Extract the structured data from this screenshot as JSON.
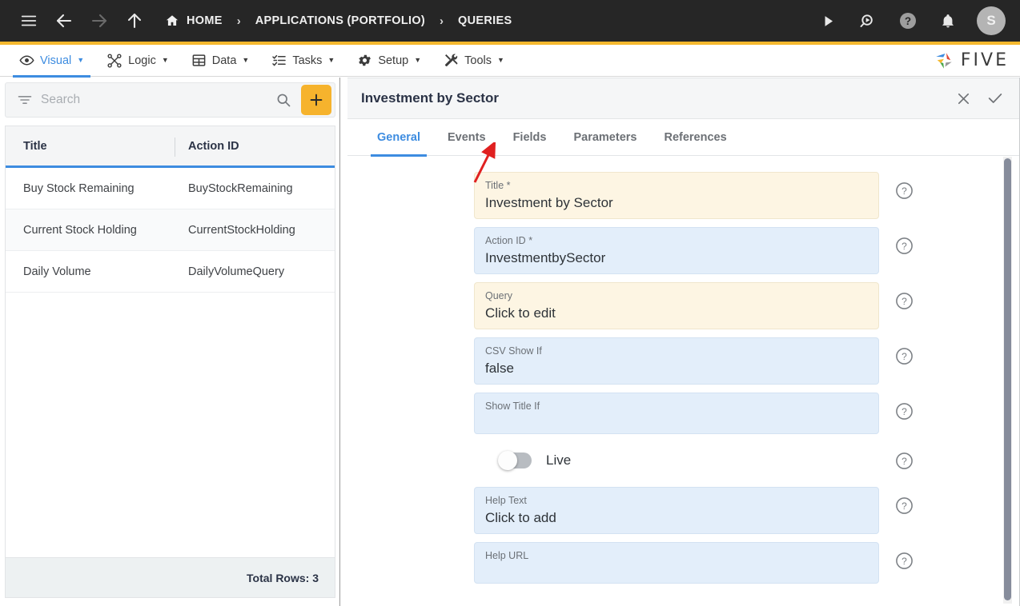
{
  "topbar": {
    "icons": {
      "menu": "hamburger-icon",
      "back": "arrow-left-icon",
      "forward": "arrow-right-icon",
      "up": "arrow-up-icon",
      "run": "play-icon",
      "search": "search-play-icon",
      "help": "question-circle-icon",
      "notifications": "bell-icon"
    },
    "breadcrumbs": [
      {
        "label": "HOME",
        "icon": "home-icon"
      },
      {
        "label": "APPLICATIONS (PORTFOLIO)",
        "icon": ""
      },
      {
        "label": "QUERIES",
        "icon": ""
      }
    ],
    "separator": "›",
    "avatar_initial": "S",
    "background": "#262626",
    "accent": "#F5B82E"
  },
  "menubar": {
    "items": [
      {
        "label": "Visual",
        "icon": "eye-icon",
        "active": true
      },
      {
        "label": "Logic",
        "icon": "logic-nodes-icon",
        "active": false
      },
      {
        "label": "Data",
        "icon": "table-grid-icon",
        "active": false
      },
      {
        "label": "Tasks",
        "icon": "checklist-icon",
        "active": false
      },
      {
        "label": "Setup",
        "icon": "gear-icon",
        "active": false
      },
      {
        "label": "Tools",
        "icon": "tools-icon",
        "active": false
      }
    ],
    "caret": "▼",
    "logo_text": "FIVE",
    "active_color": "#3d8ce0"
  },
  "left_panel": {
    "search": {
      "placeholder": "Search",
      "value": "",
      "filter_icon": "filter-icon",
      "search_icon": "magnifier-icon",
      "add_icon": "plus-icon",
      "add_color": "#F6B32D"
    },
    "grid": {
      "columns": [
        "Title",
        "Action ID"
      ],
      "rows": [
        {
          "title": "Buy Stock Remaining",
          "action_id": "BuyStockRemaining"
        },
        {
          "title": "Current Stock Holding",
          "action_id": "CurrentStockHolding"
        },
        {
          "title": "Daily Volume",
          "action_id": "DailyVolumeQuery"
        }
      ]
    },
    "footer": "Total Rows: 3"
  },
  "right_panel": {
    "title": "Investment by Sector",
    "actions": [
      {
        "name": "close-icon",
        "glyph": "×"
      },
      {
        "name": "confirm-check-icon",
        "glyph": "✓"
      }
    ],
    "tabs": [
      {
        "label": "General",
        "active": true
      },
      {
        "label": "Events",
        "active": false
      },
      {
        "label": "Fields",
        "active": false
      },
      {
        "label": "Parameters",
        "active": false
      },
      {
        "label": "References",
        "active": false
      }
    ],
    "fields": [
      {
        "label": "Title",
        "required": true,
        "value": "Investment by Sector",
        "style": "cream",
        "tall": false
      },
      {
        "label": "Action ID",
        "required": true,
        "value": "InvestmentbySector",
        "style": "blue",
        "tall": false
      },
      {
        "label": "Query",
        "required": false,
        "value": "Click to edit",
        "style": "cream",
        "tall": false
      },
      {
        "label": "CSV Show If",
        "required": false,
        "value": "false",
        "style": "blue",
        "tall": false
      },
      {
        "label": "Show Title If",
        "required": false,
        "value": "",
        "style": "blue",
        "tall": true
      }
    ],
    "toggle": {
      "label": "Live",
      "on": false
    },
    "fields_after": [
      {
        "label": "Help Text",
        "required": false,
        "value": "Click to add",
        "style": "blue",
        "tall": false
      },
      {
        "label": "Help URL",
        "required": false,
        "value": "",
        "style": "blue",
        "tall": true
      }
    ],
    "help_icon": "question-circle-icon",
    "required_marker": "*"
  },
  "annotation": {
    "name": "red-arrow-pointing-to-fields-tab",
    "color": "#e02020"
  }
}
